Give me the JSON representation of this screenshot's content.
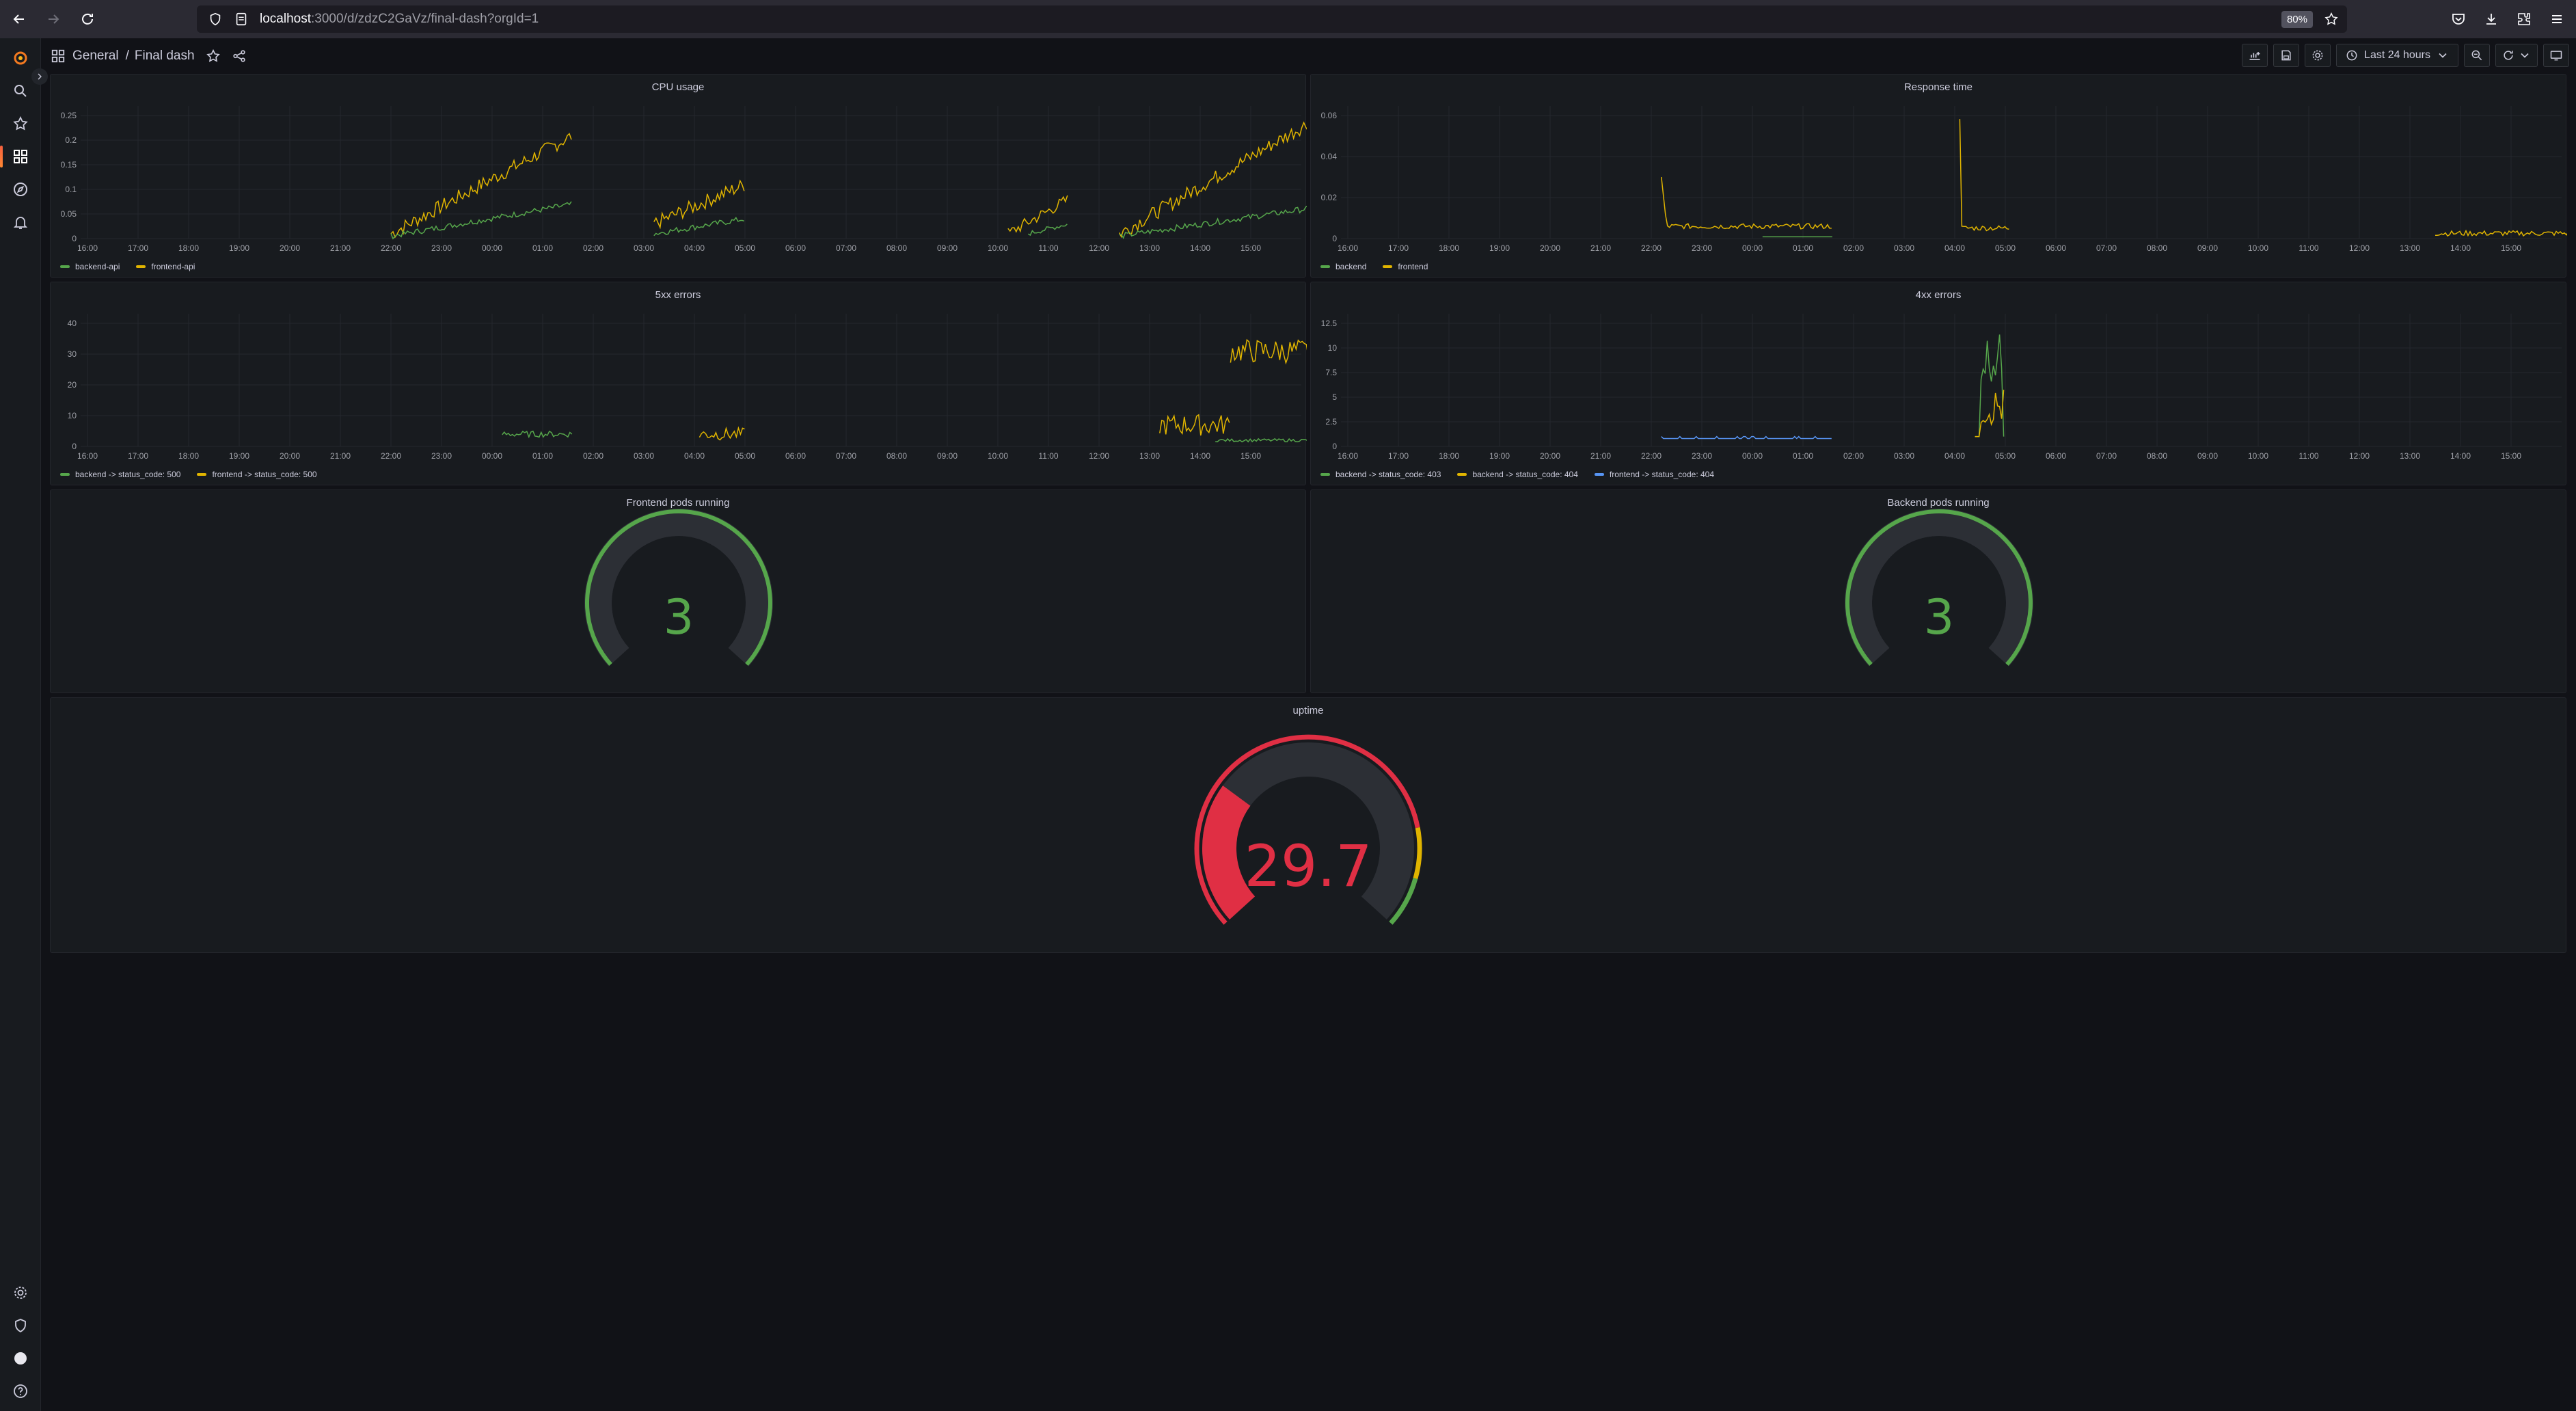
{
  "browser": {
    "url_host": "localhost",
    "url_path": ":3000/d/zdzC2GaVz/final-dash?orgId=1",
    "zoom": "80%"
  },
  "topnav": {
    "folder": "General",
    "separator": "/",
    "dashboard_title": "Final dash",
    "time_range": "Last 24 hours"
  },
  "colors": {
    "green": "#56a64b",
    "yellow": "#e0b400",
    "blue": "#5794f2",
    "red": "#e02f44",
    "orange": "#e0b400"
  },
  "panels": {
    "cpu": {
      "title": "CPU usage",
      "y_ticks": [
        "0",
        "0.05",
        "0.1",
        "0.15",
        "0.2",
        "0.25"
      ],
      "x_ticks": [
        "16:00",
        "17:00",
        "18:00",
        "19:00",
        "20:00",
        "21:00",
        "22:00",
        "23:00",
        "00:00",
        "01:00",
        "02:00",
        "03:00",
        "04:00",
        "05:00",
        "06:00",
        "07:00",
        "08:00",
        "09:00",
        "10:00",
        "11:00",
        "12:00",
        "13:00",
        "14:00",
        "15:00"
      ],
      "legend": [
        {
          "name": "backend-api",
          "color": "#56a64b"
        },
        {
          "name": "frontend-api",
          "color": "#e0b400"
        }
      ]
    },
    "response": {
      "title": "Response time",
      "y_ticks": [
        "0",
        "0.02",
        "0.04",
        "0.06"
      ],
      "x_ticks": [
        "16:00",
        "17:00",
        "18:00",
        "19:00",
        "20:00",
        "21:00",
        "22:00",
        "23:00",
        "00:00",
        "01:00",
        "02:00",
        "03:00",
        "04:00",
        "05:00",
        "06:00",
        "07:00",
        "08:00",
        "09:00",
        "10:00",
        "11:00",
        "12:00",
        "13:00",
        "14:00",
        "15:00"
      ],
      "legend": [
        {
          "name": "backend",
          "color": "#56a64b"
        },
        {
          "name": "frontend",
          "color": "#e0b400"
        }
      ]
    },
    "errors5xx": {
      "title": "5xx errors",
      "y_ticks": [
        "0",
        "10",
        "20",
        "30",
        "40"
      ],
      "x_ticks": [
        "16:00",
        "17:00",
        "18:00",
        "19:00",
        "20:00",
        "21:00",
        "22:00",
        "23:00",
        "00:00",
        "01:00",
        "02:00",
        "03:00",
        "04:00",
        "05:00",
        "06:00",
        "07:00",
        "08:00",
        "09:00",
        "10:00",
        "11:00",
        "12:00",
        "13:00",
        "14:00",
        "15:00"
      ],
      "legend": [
        {
          "name": "backend -> status_code: 500",
          "color": "#56a64b"
        },
        {
          "name": "frontend -> status_code: 500",
          "color": "#e0b400"
        }
      ]
    },
    "errors4xx": {
      "title": "4xx errors",
      "y_ticks": [
        "0",
        "2.5",
        "5",
        "7.5",
        "10",
        "12.5"
      ],
      "x_ticks": [
        "16:00",
        "17:00",
        "18:00",
        "19:00",
        "20:00",
        "21:00",
        "22:00",
        "23:00",
        "00:00",
        "01:00",
        "02:00",
        "03:00",
        "04:00",
        "05:00",
        "06:00",
        "07:00",
        "08:00",
        "09:00",
        "10:00",
        "11:00",
        "12:00",
        "13:00",
        "14:00",
        "15:00"
      ],
      "legend": [
        {
          "name": "backend -> status_code: 403",
          "color": "#56a64b"
        },
        {
          "name": "backend -> status_code: 404",
          "color": "#e0b400"
        },
        {
          "name": "frontend -> status_code: 404",
          "color": "#5794f2"
        }
      ]
    },
    "frontend_pods": {
      "title": "Frontend pods running",
      "value": "3",
      "fraction": 1.0
    },
    "backend_pods": {
      "title": "Backend pods running",
      "value": "3",
      "fraction": 1.0
    },
    "uptime": {
      "title": "uptime",
      "value": "29.7",
      "fraction": 0.297
    }
  }
}
